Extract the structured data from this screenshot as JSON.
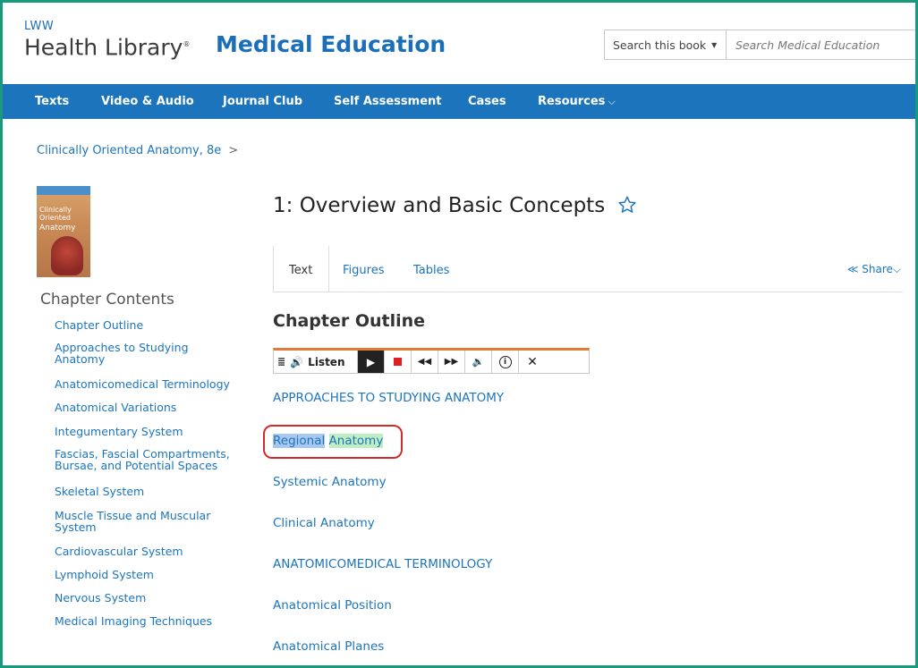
{
  "header": {
    "logo_lww": "LWW",
    "logo_health_library": "Health Library",
    "logo_reg": "®",
    "site_title": "Medical Education",
    "search": {
      "scope_label": "Search this book",
      "placeholder": "Search Medical Education"
    }
  },
  "nav": {
    "items": [
      {
        "label": "Texts"
      },
      {
        "label": "Video & Audio"
      },
      {
        "label": "Journal Club"
      },
      {
        "label": "Self Assessment"
      },
      {
        "label": "Cases"
      },
      {
        "label": "Resources"
      }
    ]
  },
  "breadcrumb": {
    "book": "Clinically Oriented Anatomy, 8e",
    "separator": ">"
  },
  "sidebar": {
    "cover": {
      "line1": "Clinically",
      "line2": "Oriented",
      "line3": "Anatomy"
    },
    "title": "Chapter Contents",
    "items": [
      "Chapter Outline",
      "Approaches to Studying",
      "Anatomy",
      "Anatomicomedical Terminology",
      "Anatomical Variations",
      "Integumentary System",
      "Fascias, Fascial Compartments,",
      "Bursae, and Potential Spaces",
      "Skeletal System",
      "Muscle Tissue and Muscular",
      "System",
      "Cardiovascular System",
      "Lymphoid System",
      "Nervous System",
      "Medical Imaging Techniques"
    ]
  },
  "main": {
    "chapter_title": "1: Overview and Basic Concepts",
    "tabs": [
      {
        "label": "Text",
        "active": true
      },
      {
        "label": "Figures"
      },
      {
        "label": "Tables"
      }
    ],
    "share_label": "Share",
    "outline_heading": "Chapter Outline",
    "listen_toolbar": {
      "listen_label": "Listen"
    },
    "outline_links": [
      "APPROACHES TO STUDYING ANATOMY",
      "Regional",
      "Anatomy",
      "Systemic Anatomy",
      "Clinical Anatomy",
      "ANATOMICOMEDICAL TERMINOLOGY",
      "Anatomical Position",
      "Anatomical Planes"
    ]
  },
  "colors": {
    "frame": "#1a9a7c",
    "nav_bg": "#1c75bc",
    "link": "#1c75bc",
    "highlight_word": "#a9c8f1",
    "highlight_sentence": "#bfeec4",
    "annotation_ring": "#d12c2c"
  }
}
